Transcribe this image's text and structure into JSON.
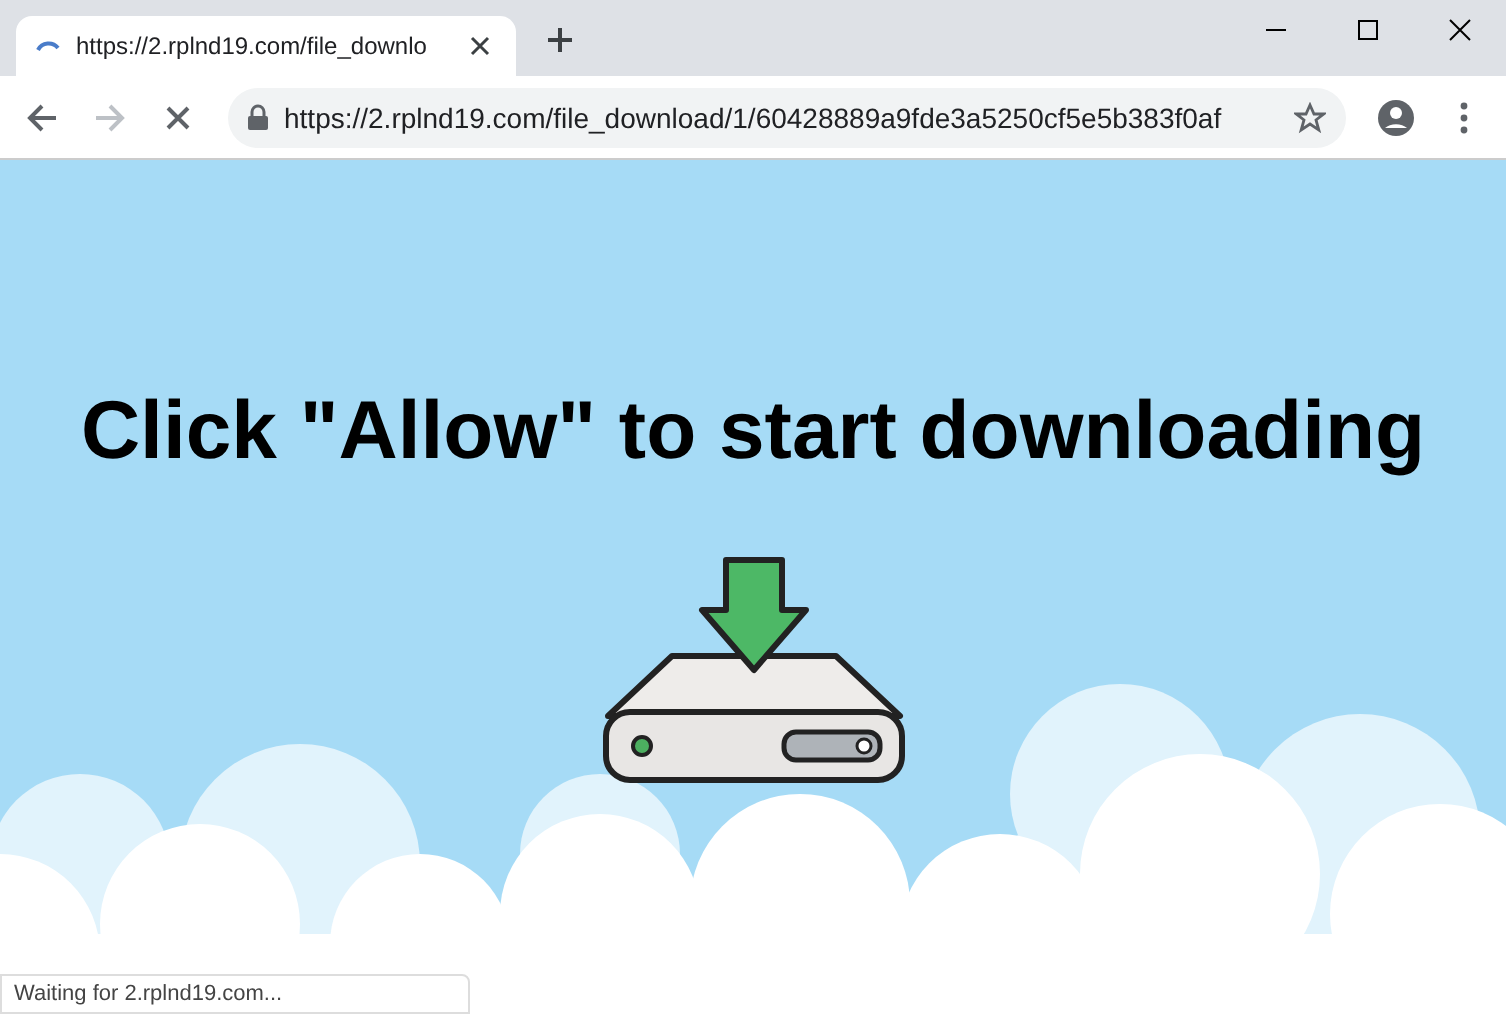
{
  "tab": {
    "title": "https://2.rplnd19.com/file_downlo",
    "loading": true
  },
  "address_bar": {
    "url": "https://2.rplnd19.com/file_download/1/60428889a9fde3a5250cf5e5b383f0af"
  },
  "page": {
    "heading": "Click \"Allow\" to start downloading"
  },
  "status_bar": {
    "text": "Waiting for 2.rplnd19.com..."
  }
}
